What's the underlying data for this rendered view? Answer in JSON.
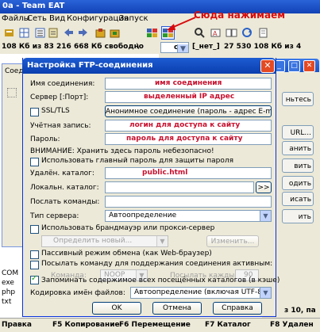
{
  "tc": {
    "title": "0a - Team EAT",
    "menu": [
      "Файлы",
      "Сеть",
      "Вид",
      "Конфигурация",
      "Запуск"
    ],
    "drive_left": "108 Кб из 83 216 668 Кб свободно",
    "drive_left_sep": "\\",
    "drive_combo": "c",
    "drive_net": "[_нет_]",
    "drive_right": "27 530 108 Кб из 4",
    "left_files": [
      "COM",
      "exe",
      "php",
      "txt"
    ],
    "right_footer": "з 10, па",
    "side_buttons": [
      "ньтесь",
      "URL...",
      "анить",
      "вить",
      "одить",
      "исать",
      "ить"
    ],
    "side_tab_label": "Соеди",
    "fkeys": [
      "Правка",
      "F5 Копирование",
      "F6 Перемещение",
      "F7 Каталог",
      "F8 Удален"
    ]
  },
  "annotation": {
    "text": "Сюда нажимаем",
    "color": "#d80c0c"
  },
  "dialog": {
    "title": "Настройка FTP-соединения",
    "close_label": "✕",
    "fields": {
      "connection_name": {
        "label": "Имя соединения:",
        "value": "имя соединения"
      },
      "server": {
        "label": "Сервер [:Порт]:",
        "value": "выделенный IP адрес"
      },
      "ssl_label": "SSL/TLS",
      "anon_button": "Анонимное соединение (пароль - адрес E-mail)",
      "account": {
        "label": "Учётная запись:",
        "value": "логин для доступа к сайту"
      },
      "password": {
        "label": "Пароль:",
        "value": "пароль для доступа к сайту"
      },
      "warning": "ВНИМАНИЕ: Хранить здесь пароль небезопасно!",
      "master_password": "Использовать главный пароль для защиты пароля",
      "remote_dir": {
        "label": "Удалён. каталог:",
        "value": "public.html"
      },
      "local_dir": {
        "label": "Локальн. каталог:",
        "value": "",
        "browse": ">>"
      },
      "send_commands": {
        "label": "Послать команды:",
        "value": ""
      },
      "server_type": {
        "label": "Тип сервера:",
        "value": "Автоопределение"
      },
      "firewall": "Использовать брандмауэр или прокси-сервер",
      "proxy_define": "Определить новый...",
      "proxy_change": "Изменить...",
      "passive": "Пассивный режим обмена (как Web-браузер)",
      "keepalive": "Посылать команду для поддержания соединения активным:",
      "command_label": "Команда:",
      "command_value": "NOOP",
      "interval_label": "Посылать каждые:",
      "interval_value": "90",
      "cache": "Запоминать содержимое всех посещённых каталогов (в кэше)",
      "encoding": {
        "label": "Кодировка имён файлов:",
        "value": "Автоопределение (включая UTF-8)"
      }
    },
    "buttons": {
      "ok": "OK",
      "cancel": "Отмена",
      "help": "Справка"
    }
  }
}
